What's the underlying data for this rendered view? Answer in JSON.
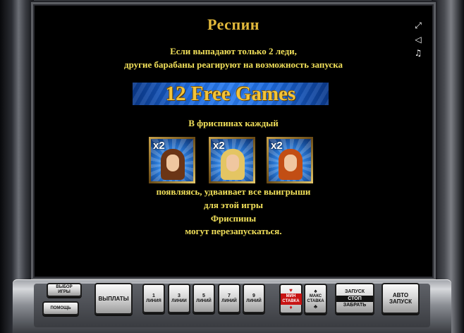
{
  "info": {
    "title": "Респин",
    "line1": "Если выпадают только 2 леди,",
    "line2": "другие барабаны реагируют на возможность запуска",
    "banner": "12 Free Games",
    "line3": "В фриспинах каждый",
    "line4": "появляясь, удваивает все выигрыши",
    "line5": "для этой игры",
    "line6": "Фриспины",
    "line7": "могут перезапускаться."
  },
  "symbols": [
    {
      "multiplier": "x2",
      "hair_color": "#6b3516"
    },
    {
      "multiplier": "x2",
      "hair_color": "#e4c563"
    },
    {
      "multiplier": "x2",
      "hair_color": "#c24e14"
    }
  ],
  "side_icons": [
    "fullscreen-icon",
    "sound-icon",
    "music-icon"
  ],
  "controls": {
    "select_game_1": "ВЫБОР",
    "select_game_2": "ИГРЫ",
    "help": "ПОМОЩЬ",
    "payouts": "ВЫПЛАТЫ",
    "lines": [
      {
        "num": "1",
        "label": "ЛИНИЯ"
      },
      {
        "num": "3",
        "label": "ЛИНИИ"
      },
      {
        "num": "5",
        "label": "ЛИНИЙ"
      },
      {
        "num": "7",
        "label": "ЛИНИЙ"
      },
      {
        "num": "9",
        "label": "ЛИНИЙ"
      }
    ],
    "min_bet_1": "МИН",
    "min_bet_2": "СТАВКА",
    "max_bet_1": "МАКС",
    "max_bet_2": "СТАВКА",
    "start_top": "ЗАПУСК",
    "start_mid": "СТОП",
    "start_bottom": "ЗАБРАТЬ",
    "auto_1": "АВТО",
    "auto_2": "ЗАПУСК"
  },
  "colors": {
    "title": "#e2b93b",
    "text": "#f1e05a",
    "banner_bg": "#1d6be0",
    "banner_text": "#f3c43a"
  }
}
